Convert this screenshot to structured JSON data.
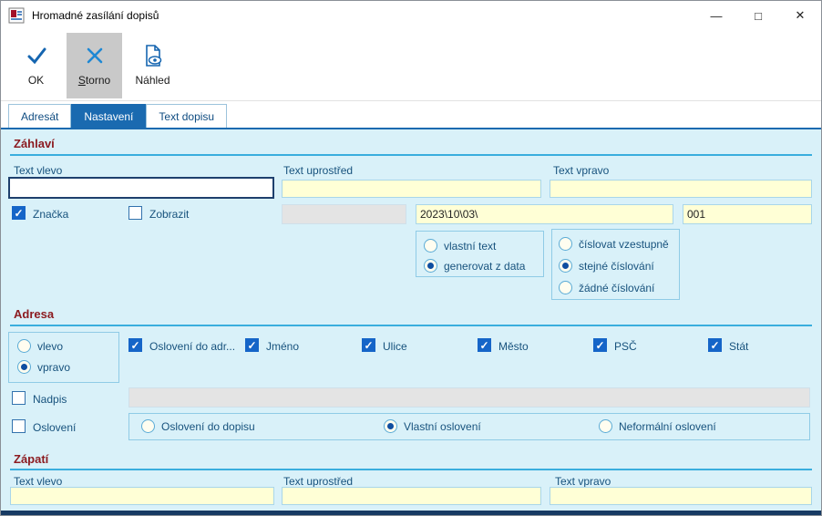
{
  "icons": {
    "check": "✓",
    "minimize": "—",
    "maximize": "□",
    "close": "✕"
  },
  "window": {
    "title": "Hromadné zasílání dopisů"
  },
  "toolbar": {
    "ok_label": "OK",
    "storno_label": "Storno",
    "nahled_label": "Náhled"
  },
  "tabs": [
    {
      "label": "Adresát"
    },
    {
      "label": "Nastavení"
    },
    {
      "label": "Text dopisu"
    }
  ],
  "zahlavi": {
    "section_title": "Záhlaví",
    "text_vlevo_label": "Text vlevo",
    "text_uprostred_label": "Text uprostřed",
    "text_vpravo_label": "Text vpravo",
    "text_vlevo_value": "",
    "text_uprostred_value": "",
    "text_vpravo_value": "",
    "znacka_label": "Značka",
    "zobrazit_label": "Zobrazit",
    "custom_text_value": "",
    "date_value": "2023\\10\\03\\",
    "number_value": "001",
    "radio_vlastni_text": "vlastní text",
    "radio_generovat_z_data": "generovat z data",
    "radio_cislovat_vzestupne": "číslovat vzestupně",
    "radio_stejne_cislovani": "stejné číslování",
    "radio_zadne_cislovani": "žádné číslování"
  },
  "adresa": {
    "section_title": "Adresa",
    "radio_vlevo": "vlevo",
    "radio_vpravo": "vpravo",
    "checkboxes": [
      "Oslovení do adr...",
      "Jméno",
      "Ulice",
      "Město",
      "PSČ",
      "Stát"
    ],
    "nadpis_label": "Nadpis",
    "nadpis_value": "",
    "osloveni_label": "Oslovení",
    "radio_osloveni_do_dopisu": "Oslovení do dopisu",
    "radio_vlastni_osloveni": "Vlastní oslovení",
    "radio_neformalni_osloveni": "Neformální oslovení"
  },
  "zapati": {
    "section_title": "Zápatí",
    "text_vlevo_label": "Text vlevo",
    "text_uprostred_label": "Text uprostřed",
    "text_vpravo_label": "Text vpravo",
    "text_vlevo_value": "",
    "text_uprostred_value": "",
    "text_vpravo_value": ""
  }
}
